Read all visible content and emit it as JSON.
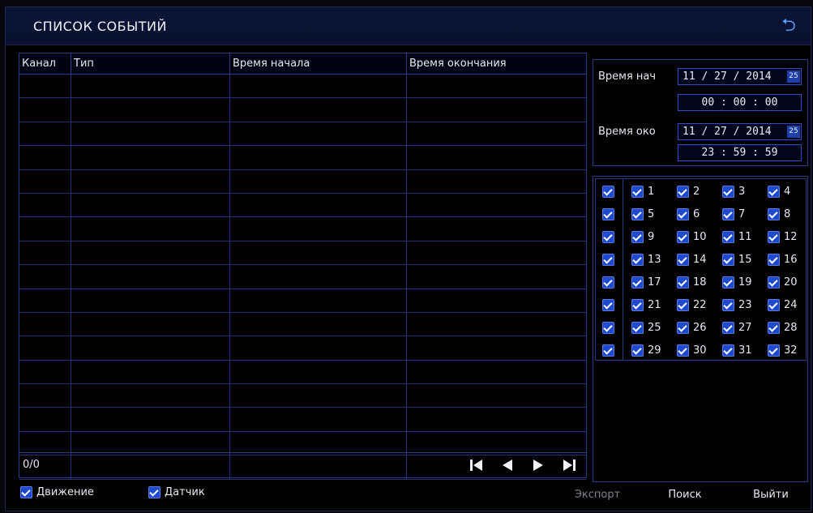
{
  "window": {
    "title": "СПИСОК СОБЫТИЙ",
    "back_icon": "back-arrow-icon"
  },
  "table": {
    "columns": [
      "Канал",
      "Тип",
      "Время начала",
      "Время окончания"
    ],
    "row_count": 17,
    "page_count": "0/0"
  },
  "time_filter": {
    "start_label": "Время нач",
    "start_date": "11 / 27 / 2014",
    "start_time": "00  :  00  :  00",
    "end_label": "Время око",
    "end_date": "11 / 27 / 2014",
    "end_time": "23  :  59  :  59",
    "calendar_icon_text": "25"
  },
  "channels": {
    "select_all": true,
    "items": [
      "1",
      "2",
      "3",
      "4",
      "5",
      "6",
      "7",
      "8",
      "9",
      "10",
      "11",
      "12",
      "13",
      "14",
      "15",
      "16",
      "17",
      "18",
      "19",
      "20",
      "21",
      "22",
      "23",
      "24",
      "25",
      "26",
      "27",
      "28",
      "29",
      "30",
      "31",
      "32"
    ]
  },
  "bottom": {
    "motion_label": "Движение",
    "sensor_label": "Датчик",
    "export_label": "Экспорт",
    "search_label": "Поиск",
    "exit_label": "Выйти"
  },
  "colors": {
    "accent": "#2e4cc8",
    "grid": "#22307a",
    "checkbox": "#1e4ad0"
  }
}
